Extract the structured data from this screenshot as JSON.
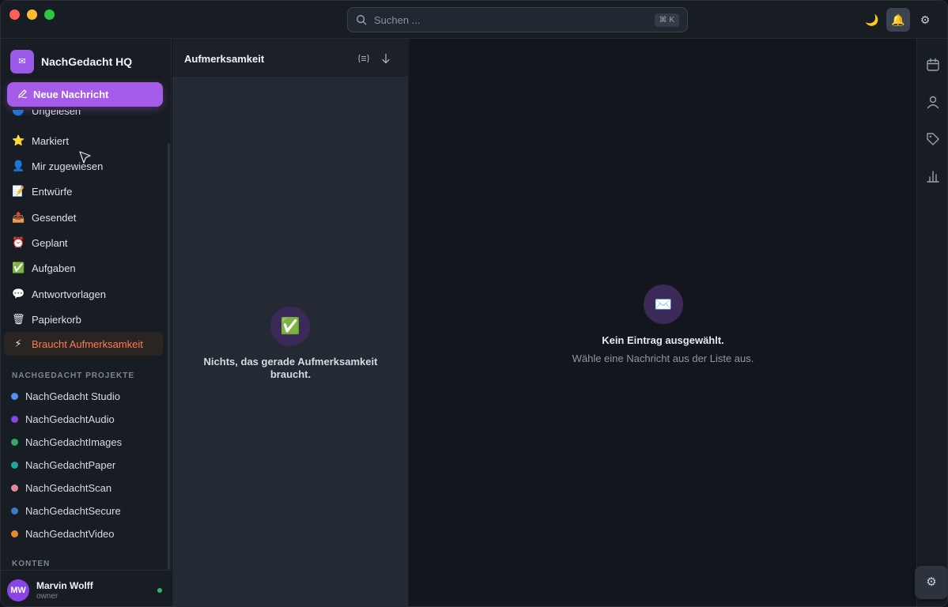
{
  "search": {
    "placeholder": "Suchen ...",
    "shortcut": "⌘ K"
  },
  "toolbar": {
    "theme_icon": "🌙",
    "bell_icon": "🔔",
    "settings_icon": "⚙"
  },
  "org": {
    "logo_icon": "✉",
    "name": "NachGedacht HQ"
  },
  "compose": {
    "label": "Neue Nachricht"
  },
  "nav": {
    "items": [
      {
        "icon": "🔵",
        "label": "Ungelesen"
      },
      {
        "icon": "⭐",
        "label": "Markiert"
      },
      {
        "icon": "👤",
        "label": "Mir zugewiesen"
      },
      {
        "icon": "📝",
        "label": "Entwürfe"
      },
      {
        "icon": "📤",
        "label": "Gesendet"
      },
      {
        "icon": "⏰",
        "label": "Geplant"
      },
      {
        "icon": "✅",
        "label": "Aufgaben"
      },
      {
        "icon": "💬",
        "label": "Antwortvorlagen"
      },
      {
        "icon": "🗑",
        "label": "Papierkorb"
      },
      {
        "icon": "⚡",
        "label": "Braucht Aufmerksamkeit"
      }
    ]
  },
  "projects": {
    "label": "NACHGEDACHT PROJEKTE",
    "items": [
      {
        "label": "NachGedacht Studio",
        "color": "#4f8ff7"
      },
      {
        "label": "NachGedachtAudio",
        "color": "#8a44e6"
      },
      {
        "label": "NachGedachtImages",
        "color": "#2fa86a"
      },
      {
        "label": "NachGedachtPaper",
        "color": "#1fa39a"
      },
      {
        "label": "NachGedachtScan",
        "color": "#e08a95"
      },
      {
        "label": "NachGedachtSecure",
        "color": "#3f79c6"
      },
      {
        "label": "NachGedachtVideo",
        "color": "#e8892e"
      }
    ]
  },
  "accounts": {
    "label": "KONTEN"
  },
  "user": {
    "initials": "MW",
    "name": "Marvin Wolff",
    "role": "owner"
  },
  "list": {
    "title": "Aufmerksamkeit",
    "empty_icon": "✅",
    "empty_text": "Nichts, das gerade Aufmerksamkeit braucht."
  },
  "detail": {
    "icon": "✉️",
    "title": "Kein Eintrag ausgewählt.",
    "subtitle": "Wähle eine Nachricht aus der Liste aus."
  },
  "rail": {
    "settings_icon": "⚙"
  },
  "colors": {
    "accent": "#a55de9",
    "attention": "#ff7b56"
  }
}
